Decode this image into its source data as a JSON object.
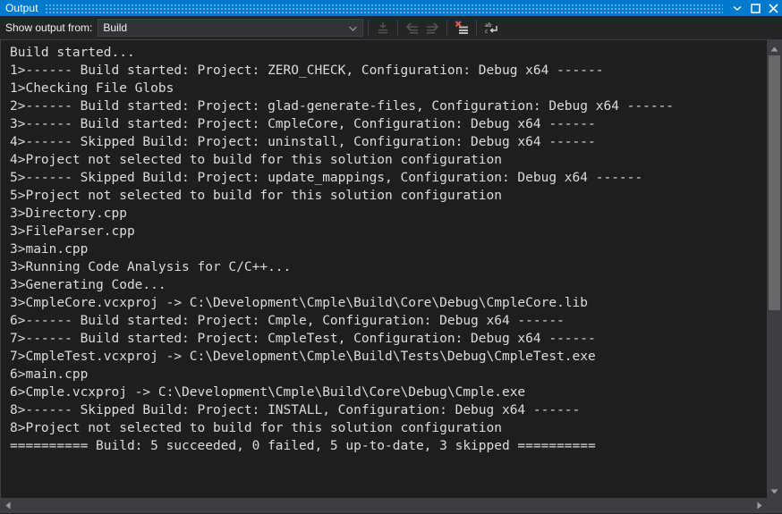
{
  "window": {
    "title": "Output",
    "titlebar_buttons": [
      {
        "name": "window-menu-dropdown",
        "icon": "chevron-down-icon"
      },
      {
        "name": "float-window-button",
        "icon": "maximize-square-icon"
      },
      {
        "name": "close-window-button",
        "icon": "close-x-icon"
      }
    ]
  },
  "toolbar": {
    "show_output_from_label": "Show output from:",
    "selected_source": "Build",
    "source_options": [
      "Build"
    ],
    "buttons": [
      {
        "name": "find-message-in-code-button",
        "icon": "go-to-message-icon",
        "enabled": false
      },
      {
        "name": "navigate-back-button",
        "icon": "arrow-left-icon",
        "enabled": false
      },
      {
        "name": "navigate-forward-button",
        "icon": "arrow-right-icon",
        "enabled": false
      },
      {
        "name": "clear-all-button",
        "icon": "clear-all-icon",
        "enabled": true
      },
      {
        "name": "toggle-word-wrap-button",
        "icon": "word-wrap-icon",
        "enabled": true
      }
    ]
  },
  "output": {
    "lines": [
      "Build started...",
      "1>------ Build started: Project: ZERO_CHECK, Configuration: Debug x64 ------",
      "1>Checking File Globs",
      "2>------ Build started: Project: glad-generate-files, Configuration: Debug x64 ------",
      "3>------ Build started: Project: CmpleCore, Configuration: Debug x64 ------",
      "4>------ Skipped Build: Project: uninstall, Configuration: Debug x64 ------",
      "4>Project not selected to build for this solution configuration",
      "5>------ Skipped Build: Project: update_mappings, Configuration: Debug x64 ------",
      "5>Project not selected to build for this solution configuration",
      "3>Directory.cpp",
      "3>FileParser.cpp",
      "3>main.cpp",
      "3>Running Code Analysis for C/C++...",
      "3>Generating Code...",
      "3>CmpleCore.vcxproj -> C:\\Development\\Cmple\\Build\\Core\\Debug\\CmpleCore.lib",
      "6>------ Build started: Project: Cmple, Configuration: Debug x64 ------",
      "7>------ Build started: Project: CmpleTest, Configuration: Debug x64 ------",
      "7>CmpleTest.vcxproj -> C:\\Development\\Cmple\\Build\\Tests\\Debug\\CmpleTest.exe",
      "6>main.cpp",
      "6>Cmple.vcxproj -> C:\\Development\\Cmple\\Build\\Core\\Debug\\Cmple.exe",
      "8>------ Skipped Build: Project: INSTALL, Configuration: Debug x64 ------",
      "8>Project not selected to build for this solution configuration",
      "========== Build: 5 succeeded, 0 failed, 5 up-to-date, 3 skipped =========="
    ],
    "summary": {
      "succeeded": 5,
      "failed": 0,
      "up_to_date": 5,
      "skipped": 3
    }
  },
  "scrollbars": {
    "vertical": {
      "up_arrow": "triangle-up-icon",
      "down_arrow": "triangle-down-icon"
    },
    "horizontal": {
      "left_arrow": "triangle-left-icon",
      "right_arrow": "triangle-right-icon"
    }
  },
  "colors": {
    "titlebar": "#007ACC",
    "toolbar_bg": "#252526",
    "text_bg": "#1E1E1E",
    "text_fg": "#DCDCDC",
    "scrollbar_track": "#3E3E42",
    "scrollbar_thumb": "#686868",
    "accent_red": "#E05A4E"
  }
}
